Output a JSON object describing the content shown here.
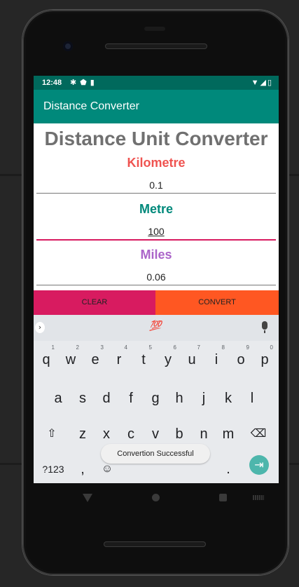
{
  "status_bar": {
    "time": "12:48"
  },
  "app_bar": {
    "title": "Distance Converter"
  },
  "heading": "Distance Unit Converter",
  "units": [
    {
      "label": "Kilometre",
      "value": "0.1",
      "color": "#ef5350"
    },
    {
      "label": "Metre",
      "value": "100",
      "color": "#00897b"
    },
    {
      "label": "Miles",
      "value": "0.06",
      "color": "#ab64c9"
    }
  ],
  "buttons": {
    "clear": {
      "label": "CLEAR",
      "color": "#d81b60"
    },
    "convert": {
      "label": "CONVERT",
      "color": "#ff5722"
    }
  },
  "keyboard": {
    "emoji_suggestion": "💯",
    "row1": [
      "q",
      "w",
      "e",
      "r",
      "t",
      "y",
      "u",
      "i",
      "o",
      "p"
    ],
    "row1_hints": [
      "1",
      "2",
      "3",
      "4",
      "5",
      "6",
      "7",
      "8",
      "9",
      "0"
    ],
    "row2": [
      "a",
      "s",
      "d",
      "f",
      "g",
      "h",
      "j",
      "k",
      "l"
    ],
    "row3": [
      "z",
      "x",
      "c",
      "v",
      "b",
      "n",
      "m"
    ],
    "symbols_key": "?123",
    "comma_key": ",",
    "period_key": "."
  },
  "toast": "Convertion Successful"
}
